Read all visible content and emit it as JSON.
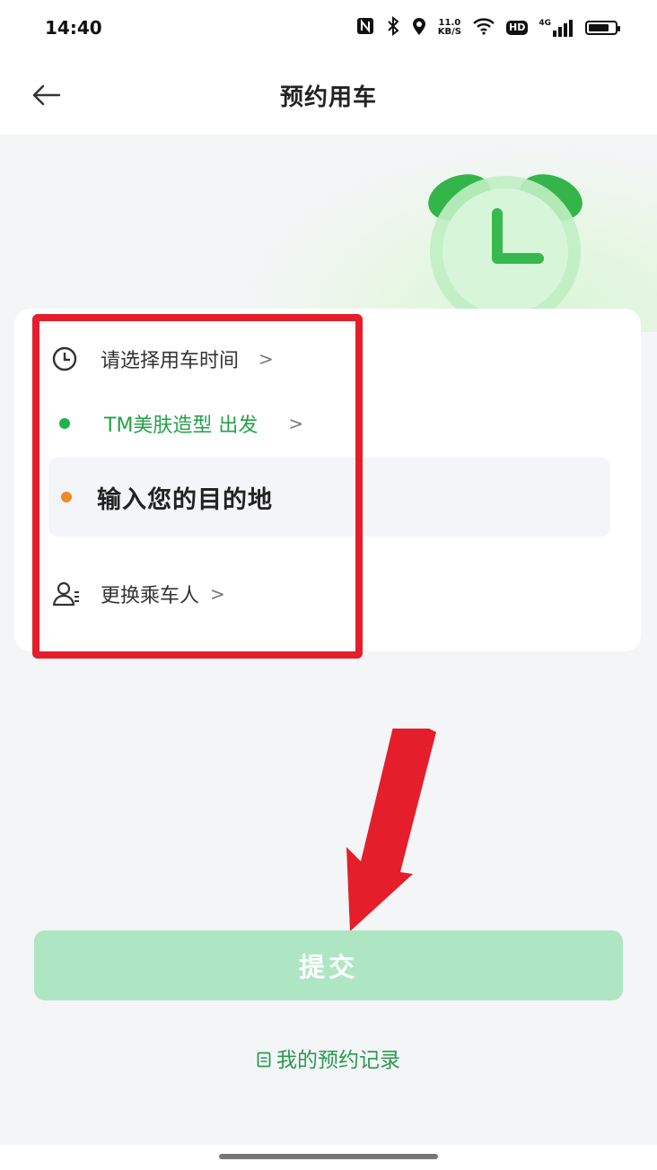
{
  "status_bar": {
    "time": "14:40",
    "net_speed_value": "11.0",
    "net_speed_unit": "KB/S",
    "hd_label": "HD",
    "network_label": "4G",
    "icons": [
      "nfc-icon",
      "bluetooth-icon",
      "location-icon",
      "wifi-icon",
      "hd-icon",
      "signal-icon",
      "battery-icon"
    ]
  },
  "nav": {
    "title": "预约用车",
    "back_icon": "back-arrow-icon"
  },
  "form": {
    "time_label": "请选择用车时间",
    "origin_label": "TM美肤造型 出发",
    "destination_label": "输入您的目的地",
    "passenger_label": "更换乘车人",
    "chevron": ">"
  },
  "actions": {
    "submit_label": "提交",
    "records_label": "我的预约记录"
  },
  "colors": {
    "accent_green": "#22b24c",
    "origin_text": "#24a148",
    "destination_dot": "#f08a24",
    "submit_bg_disabled": "#aee6c4",
    "annotation_red": "#e41e2b"
  }
}
